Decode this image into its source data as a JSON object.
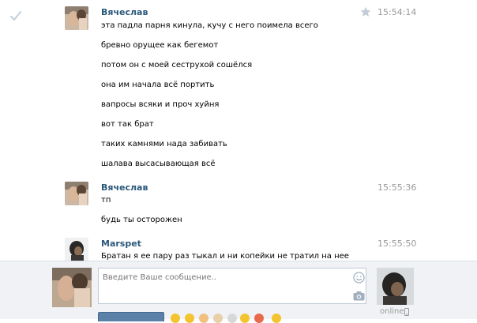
{
  "composer": {
    "placeholder": "Введите Ваше сообщение..",
    "status": "online"
  },
  "messages": [
    {
      "author": "Вячеслав",
      "time": "15:54:14",
      "lines": [
        "эта падла парня кинула, кучу с него поимела всего",
        "бревно орущее как бегемот",
        "потом он с моей сеструхой сошёлся",
        "она им начала всё портить",
        "вапросы всяки и проч хуйня",
        "вот так брат",
        "таких камнями нада забивать",
        "шалава высасывающая всё"
      ]
    },
    {
      "author": "Вячеслав",
      "time": "15:55:36",
      "lines": [
        "тп",
        "будь ты осторожен"
      ]
    },
    {
      "author": "Marspet",
      "time": "15:55:50",
      "lines": [
        "Братан я ее пару раз тыкал и ни копейки не тратил на нее"
      ]
    }
  ],
  "icons": {
    "check": "check-icon",
    "star": "star-icon",
    "smile": "smile-icon",
    "camera": "camera-icon",
    "phone": "phone-icon"
  },
  "colors": {
    "author": "#2b587a",
    "time": "#999999",
    "composer_bg": "#f0f2f5",
    "send_button": "#5b81a8"
  }
}
